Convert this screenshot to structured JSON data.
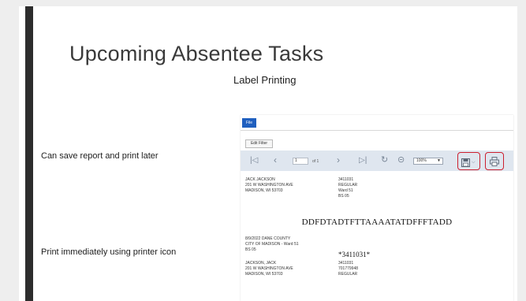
{
  "slide": {
    "title": "Upcoming Absentee Tasks",
    "subtitle": "Label Printing",
    "notes": {
      "save": "Can save report and print later",
      "print": "Print immediately using printer icon"
    },
    "accent_color": "#cc1f2f"
  },
  "report_viewer": {
    "menu": {
      "file_label": "File"
    },
    "edit_filter_label": "Edit Filter",
    "toolbar": {
      "first_icon": "first-page-icon",
      "prev_icon": "previous-page-icon",
      "page_value": "1",
      "page_of": "of 1",
      "next_icon": "next-page-icon",
      "last_icon": "last-page-icon",
      "refresh_icon": "refresh-icon",
      "back_icon": "back-icon",
      "zoom_value": "100%",
      "save_icon": "save-icon",
      "print_icon": "printer-icon"
    },
    "label1": {
      "address": "JACK  JACKSON\n201 W WASHINGTON AVE\nMADISON, WI 53703",
      "details": "3411031\nREGULAR\nWard 51\nBS 05"
    },
    "barcode_line": "DDFDTADTFTTAAAATATDFFFTADD",
    "label2": {
      "header": "8/9/2022  DANE COUNTY\nCITY OF MADISON  -  Ward 51\nBS 05",
      "serial": "*3411031*",
      "address": "JACKSON, JACK\n201 W WASHINGTON AVE\nMADISON, WI 53703",
      "details": "3411031\n701779948\nREGULAR"
    }
  }
}
